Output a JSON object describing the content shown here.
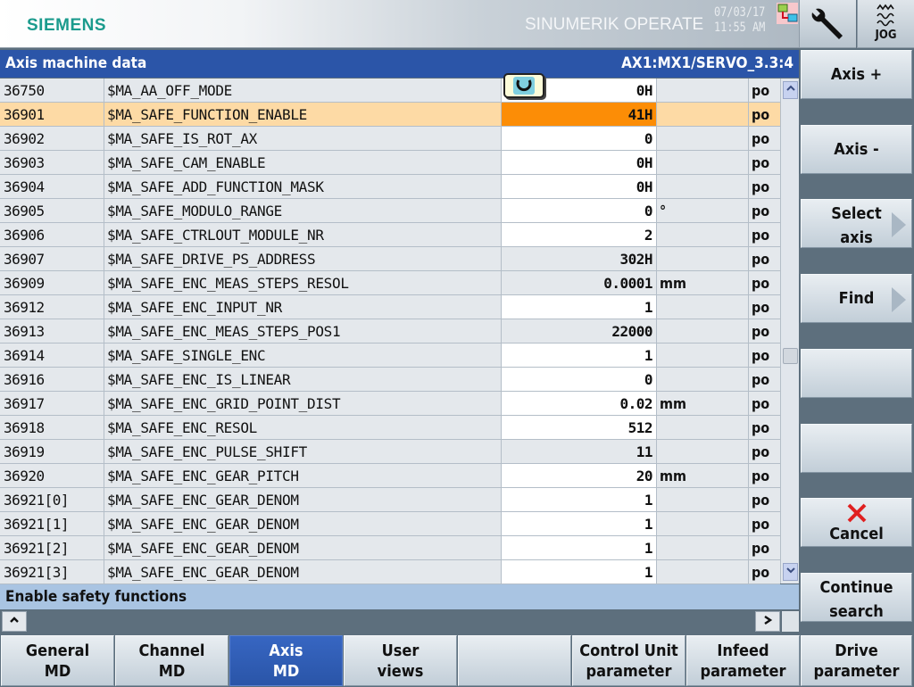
{
  "header": {
    "logo": "SIEMENS",
    "product": "SINUMERIK OPERATE",
    "date": "07/03/17",
    "time": "11:55 AM",
    "network_icon": "network-connection-icon",
    "wrench_icon": "wrench-icon",
    "jog_label": "JOG"
  },
  "titlebar": {
    "title": "Axis machine data",
    "axis_path": "AX1:MX1/SERVO_3.3:4"
  },
  "table": {
    "rows": [
      {
        "num": "36750",
        "name": "$MA_AA_OFF_MODE",
        "value": "0H",
        "unit": "",
        "action": "po",
        "editable": true
      },
      {
        "num": "36901",
        "name": "$MA_SAFE_FUNCTION_ENABLE",
        "value": "41H",
        "unit": "",
        "action": "po",
        "editable": true,
        "selected": true
      },
      {
        "num": "36902",
        "name": "$MA_SAFE_IS_ROT_AX",
        "value": "0",
        "unit": "",
        "action": "po",
        "editable": true
      },
      {
        "num": "36903",
        "name": "$MA_SAFE_CAM_ENABLE",
        "value": "0H",
        "unit": "",
        "action": "po",
        "editable": true
      },
      {
        "num": "36904",
        "name": "$MA_SAFE_ADD_FUNCTION_MASK",
        "value": "0H",
        "unit": "",
        "action": "po",
        "editable": true
      },
      {
        "num": "36905",
        "name": "$MA_SAFE_MODULO_RANGE",
        "value": "0",
        "unit": "°",
        "action": "po",
        "editable": true
      },
      {
        "num": "36906",
        "name": "$MA_SAFE_CTRLOUT_MODULE_NR",
        "value": "2",
        "unit": "",
        "action": "po",
        "editable": true
      },
      {
        "num": "36907",
        "name": "$MA_SAFE_DRIVE_PS_ADDRESS",
        "value": "302H",
        "unit": "",
        "action": "po",
        "editable": false
      },
      {
        "num": "36909",
        "name": "$MA_SAFE_ENC_MEAS_STEPS_RESOL",
        "value": "0.0001",
        "unit": "mm",
        "action": "po",
        "editable": false
      },
      {
        "num": "36912",
        "name": "$MA_SAFE_ENC_INPUT_NR",
        "value": "1",
        "unit": "",
        "action": "po",
        "editable": true
      },
      {
        "num": "36913",
        "name": "$MA_SAFE_ENC_MEAS_STEPS_POS1",
        "value": "22000",
        "unit": "",
        "action": "po",
        "editable": false
      },
      {
        "num": "36914",
        "name": "$MA_SAFE_SINGLE_ENC",
        "value": "1",
        "unit": "",
        "action": "po",
        "editable": true
      },
      {
        "num": "36916",
        "name": "$MA_SAFE_ENC_IS_LINEAR",
        "value": "0",
        "unit": "",
        "action": "po",
        "editable": true
      },
      {
        "num": "36917",
        "name": "$MA_SAFE_ENC_GRID_POINT_DIST",
        "value": "0.02",
        "unit": "mm",
        "action": "po",
        "editable": true
      },
      {
        "num": "36918",
        "name": "$MA_SAFE_ENC_RESOL",
        "value": "512",
        "unit": "",
        "action": "po",
        "editable": true
      },
      {
        "num": "36919",
        "name": "$MA_SAFE_ENC_PULSE_SHIFT",
        "value": "11",
        "unit": "",
        "action": "po",
        "editable": false
      },
      {
        "num": "36920",
        "name": "$MA_SAFE_ENC_GEAR_PITCH",
        "value": "20",
        "unit": "mm",
        "action": "po",
        "editable": true
      },
      {
        "num": "36921[0]",
        "name": "$MA_SAFE_ENC_GEAR_DENOM",
        "value": "1",
        "unit": "",
        "action": "po",
        "editable": true
      },
      {
        "num": "36921[1]",
        "name": "$MA_SAFE_ENC_GEAR_DENOM",
        "value": "1",
        "unit": "",
        "action": "po",
        "editable": true
      },
      {
        "num": "36921[2]",
        "name": "$MA_SAFE_ENC_GEAR_DENOM",
        "value": "1",
        "unit": "",
        "action": "po",
        "editable": true
      },
      {
        "num": "36921[3]",
        "name": "$MA_SAFE_ENC_GEAR_DENOM",
        "value": "1",
        "unit": "",
        "action": "po",
        "editable": true
      }
    ]
  },
  "status_text": "Enable safety functions",
  "scroll": {
    "up": "^",
    "left": "^",
    "right": ">",
    "down": "v"
  },
  "vertical_softkeys": [
    {
      "label": "Axis +"
    },
    {
      "label": "Axis -"
    },
    {
      "label": "Select axis",
      "line1": "Select",
      "line2": "axis",
      "arrow": true
    },
    {
      "label": "Find",
      "arrow": true
    },
    {
      "label": ""
    },
    {
      "label": ""
    },
    {
      "label": "Cancel",
      "icon": "cancel-x-icon"
    },
    {
      "label": "Continue search",
      "line1": "Continue",
      "line2": "search"
    }
  ],
  "horizontal_softkeys": [
    {
      "line1": "General",
      "line2": "MD"
    },
    {
      "line1": "Channel",
      "line2": "MD"
    },
    {
      "line1": "Axis",
      "line2": "MD",
      "active": true
    },
    {
      "line1": "User",
      "line2": "views"
    },
    {
      "line1": "",
      "line2": ""
    },
    {
      "line1": "Control Unit",
      "line2": "parameter"
    },
    {
      "line1": "Infeed",
      "line2": "parameter"
    },
    {
      "line1": "Drive",
      "line2": "parameter"
    }
  ],
  "colors": {
    "titlebar": "#2b55a8",
    "selected_row": "#fddaa5",
    "selected_value": "#fc8d06",
    "status_bar": "#a9c4e2",
    "logo": "#1b9b8d",
    "active_softkey": "#2b55a8"
  }
}
